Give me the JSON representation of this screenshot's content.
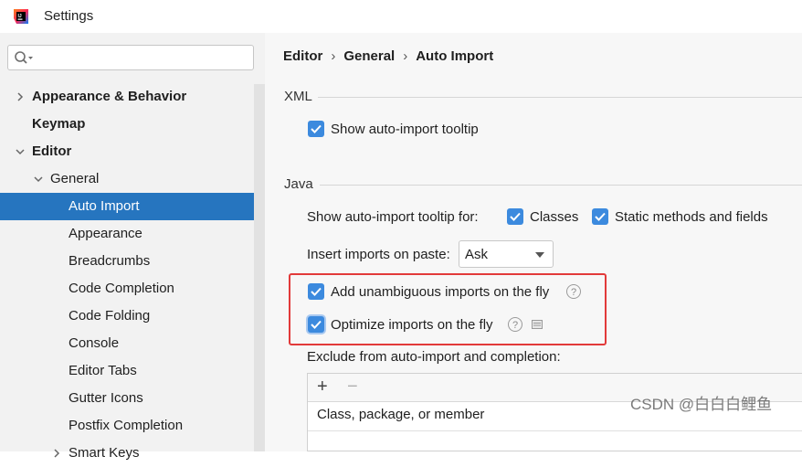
{
  "window": {
    "title": "Settings"
  },
  "search": {
    "placeholder": ""
  },
  "sidebar": {
    "items": [
      {
        "label": "Appearance & Behavior",
        "level": 0,
        "bold": true,
        "expanded": false
      },
      {
        "label": "Keymap",
        "level": 0,
        "bold": true
      },
      {
        "label": "Editor",
        "level": 0,
        "bold": true,
        "expanded": true
      },
      {
        "label": "General",
        "level": 1,
        "expanded": true
      },
      {
        "label": "Auto Import",
        "level": 2,
        "selected": true
      },
      {
        "label": "Appearance",
        "level": 2
      },
      {
        "label": "Breadcrumbs",
        "level": 2
      },
      {
        "label": "Code Completion",
        "level": 2
      },
      {
        "label": "Code Folding",
        "level": 2
      },
      {
        "label": "Console",
        "level": 2
      },
      {
        "label": "Editor Tabs",
        "level": 2
      },
      {
        "label": "Gutter Icons",
        "level": 2
      },
      {
        "label": "Postfix Completion",
        "level": 2
      },
      {
        "label": "Smart Keys",
        "level": 2
      }
    ]
  },
  "breadcrumb": {
    "part1": "Editor",
    "part2": "General",
    "part3": "Auto Import",
    "separator": "›"
  },
  "xml": {
    "title": "XML",
    "show_tooltip": {
      "label": "Show auto-import tooltip",
      "checked": true
    }
  },
  "java": {
    "title": "Java",
    "tooltip_for_label": "Show auto-import tooltip for:",
    "classes": {
      "label": "Classes",
      "checked": true
    },
    "static_methods": {
      "label": "Static methods and fields",
      "checked": true
    },
    "insert_imports_label": "Insert imports on paste:",
    "insert_imports_value": "Ask",
    "add_unambiguous": {
      "label": "Add unambiguous imports on the fly",
      "checked": true
    },
    "optimize_imports": {
      "label": "Optimize imports on the fly",
      "checked": true
    },
    "help_glyph": "?",
    "exclude_label": "Exclude from auto-import and completion:",
    "table": {
      "add": "+",
      "remove": "−",
      "column_header": "Class, package, or member"
    }
  },
  "watermark": "CSDN @白白白鲤鱼",
  "colors": {
    "accent": "#3c8ade",
    "selection": "#2675bf",
    "highlight_box": "#e23a3a"
  }
}
